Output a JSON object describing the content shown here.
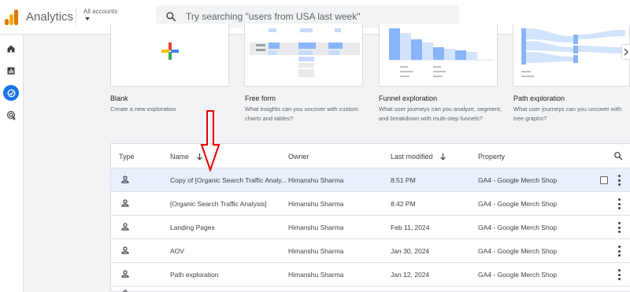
{
  "app": {
    "title": "Analytics"
  },
  "account": {
    "label": "All accounts"
  },
  "search": {
    "placeholder": "Try searching \"users from USA last week\""
  },
  "rail": [
    {
      "icon": "home-icon"
    },
    {
      "icon": "reports-icon"
    },
    {
      "icon": "explore-icon",
      "active": true
    },
    {
      "icon": "advertising-icon"
    }
  ],
  "templates": [
    {
      "title": "Blank",
      "desc": "Create a new exploration"
    },
    {
      "title": "Free form",
      "desc": "What insights can you uncover with custom charts and tables?"
    },
    {
      "title": "Funnel exploration",
      "desc": "What user journeys can you analyze, segment, and breakdown with multi-step funnels?"
    },
    {
      "title": "Path exploration",
      "desc": "What user journeys can you uncover with tree graphs?"
    }
  ],
  "table": {
    "headers": {
      "type": "Type",
      "name": "Name",
      "owner": "Owner",
      "modified": "Last modified",
      "property": "Property"
    },
    "rows": [
      {
        "name": "Copy of [Organic Search Traffic Analy...",
        "owner": "Himanshu Sharma",
        "modified": "8:51 PM",
        "property": "GA4 - Google Merch Shop"
      },
      {
        "name": "[Organic Search Traffic Analysis]",
        "owner": "Himanshu Sharma",
        "modified": "8:42 PM",
        "property": "GA4 - Google Merch Shop"
      },
      {
        "name": "Landing Pages",
        "owner": "Himanshu Sharma",
        "modified": "Feb 11, 2024",
        "property": "GA4 - Google Merch Shop"
      },
      {
        "name": "AOV",
        "owner": "Himanshu Sharma",
        "modified": "Jan 30, 2024",
        "property": "GA4 - Google Merch Shop"
      },
      {
        "name": "Path exploration",
        "owner": "Himanshu Sharma",
        "modified": "Jan 12, 2024",
        "property": "GA4 - Google Merch Shop"
      }
    ]
  },
  "colors": {
    "accent": "#1a73e8",
    "annotation": "#e60000",
    "selected_row": "#e8f0fe"
  }
}
